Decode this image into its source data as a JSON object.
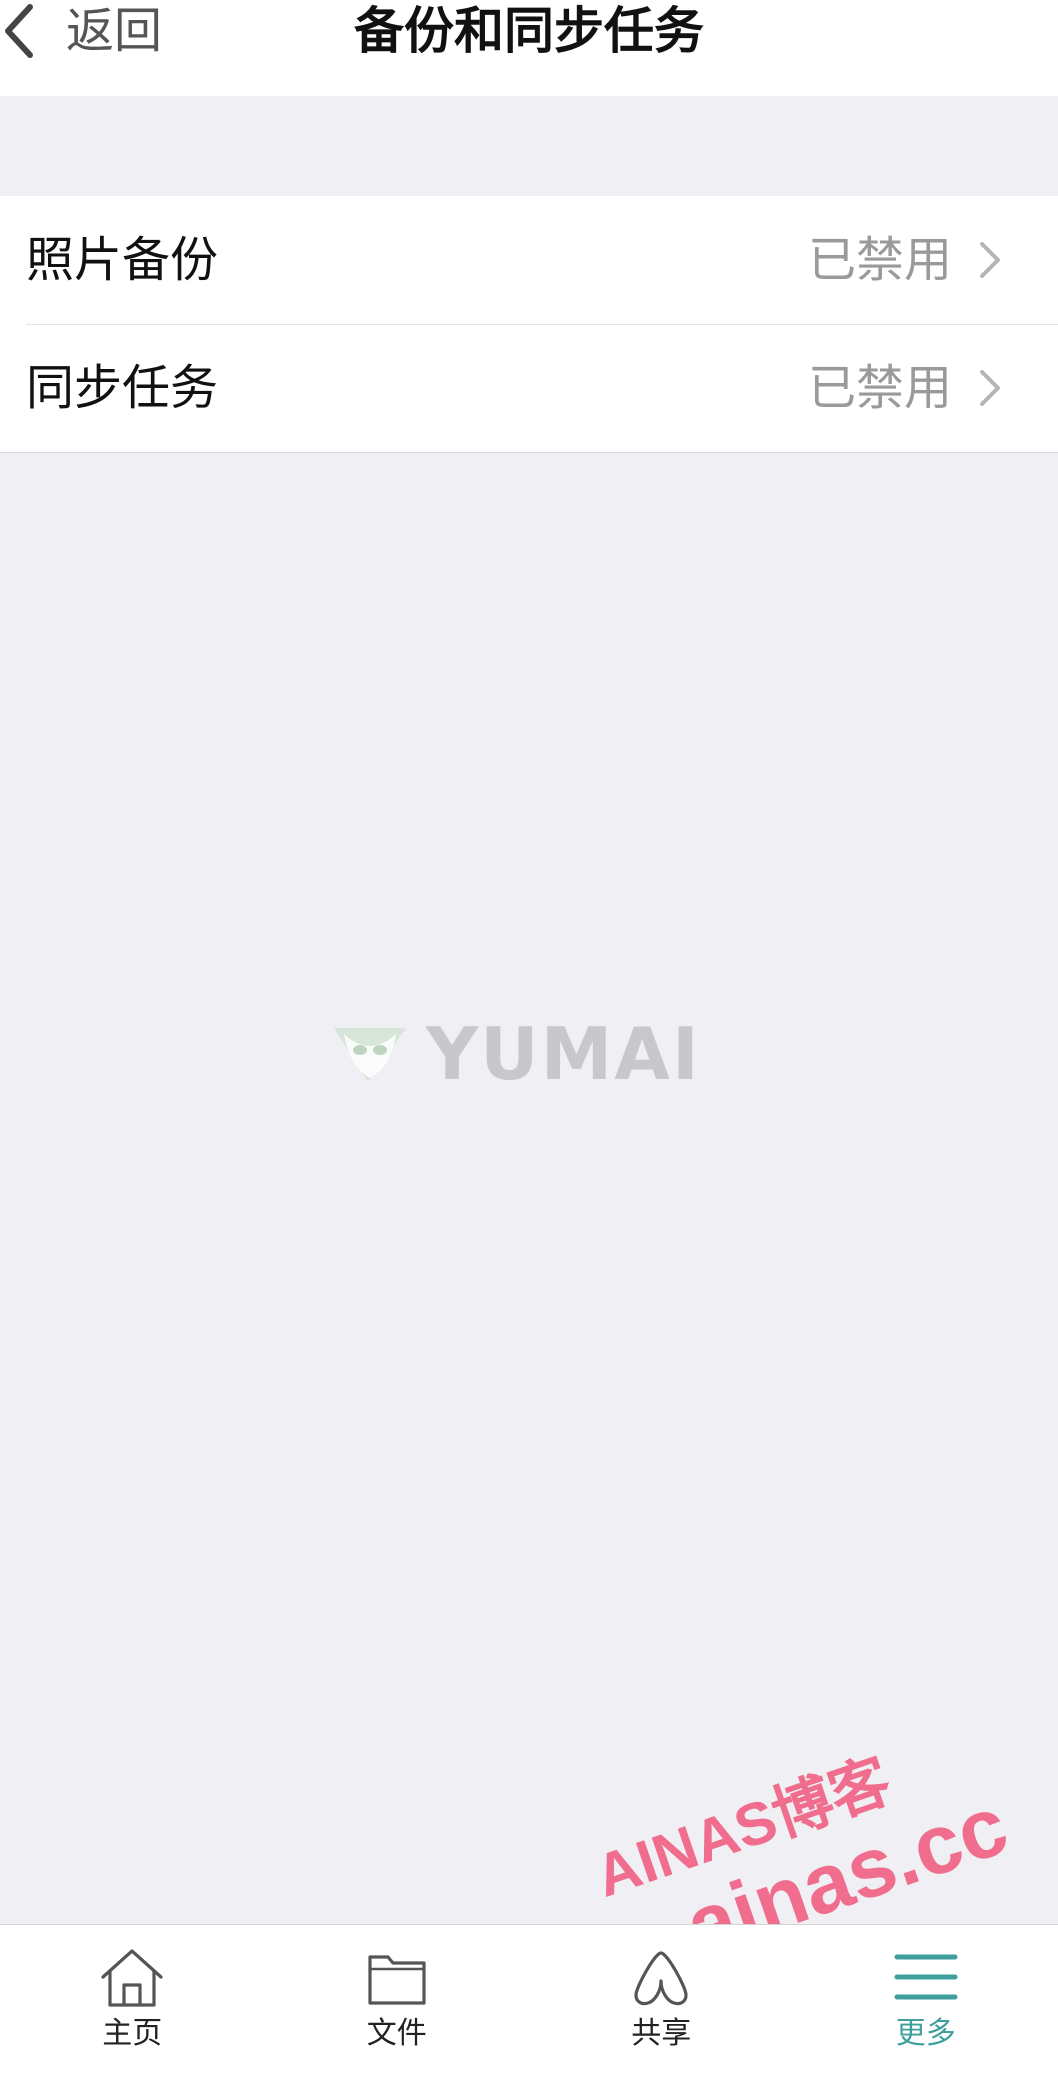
{
  "header": {
    "back_label": "返回",
    "title": "备份和同步任务"
  },
  "settings": {
    "items": [
      {
        "label": "照片备份",
        "value": "已禁用",
        "icon": "chevron-right-icon"
      },
      {
        "label": "同步任务",
        "value": "已禁用",
        "icon": "chevron-right-icon"
      }
    ]
  },
  "logo": {
    "text": "YUMAI"
  },
  "watermark": {
    "line1": "AINAS博客",
    "line2": "wp.ainas.cc"
  },
  "tabbar": {
    "tabs": [
      {
        "label": "主页",
        "icon": "home-icon",
        "active": false
      },
      {
        "label": "文件",
        "icon": "folder-icon",
        "active": false
      },
      {
        "label": "共享",
        "icon": "share-icon",
        "active": false
      },
      {
        "label": "更多",
        "icon": "menu-icon",
        "active": true
      }
    ],
    "active_color": "#3f9f9c",
    "inactive_color": "#444444"
  },
  "colors": {
    "background": "#efeff4",
    "row_value": "#9a9a9a",
    "watermark": "#f05078"
  }
}
